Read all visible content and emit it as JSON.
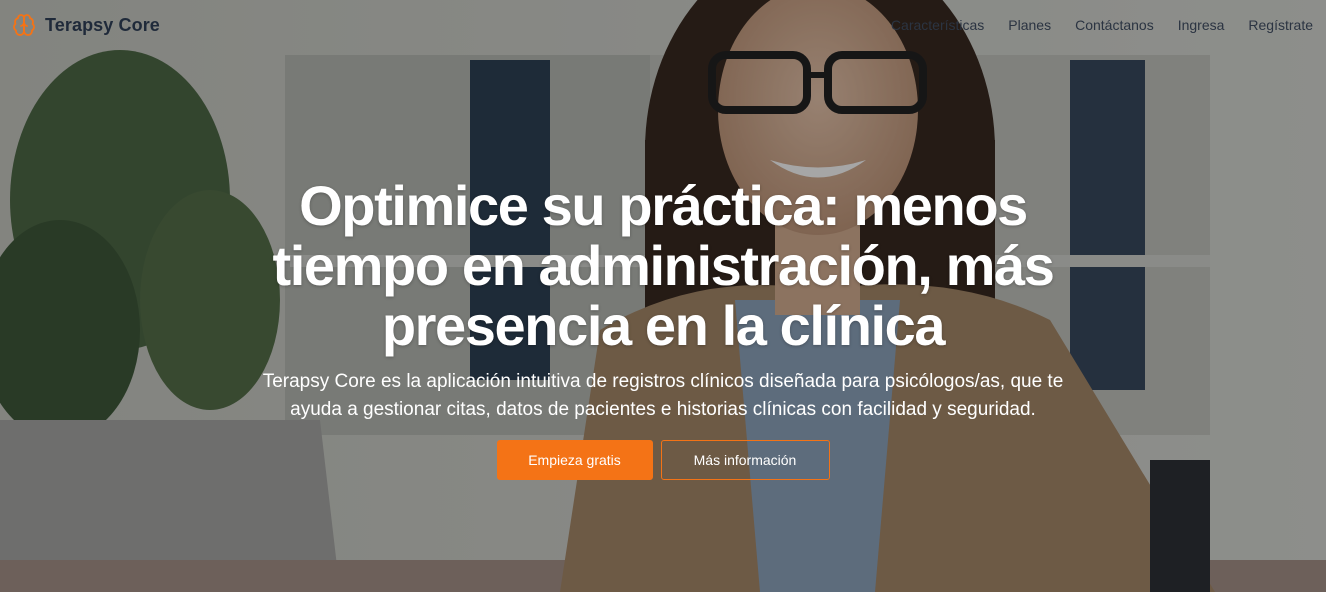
{
  "brand": {
    "name": "Terapsy Core",
    "accent_color": "#f47316",
    "icon": "brain-icon"
  },
  "nav": {
    "links": [
      {
        "label": "Características"
      },
      {
        "label": "Planes"
      },
      {
        "label": "Contáctanos"
      },
      {
        "label": "Ingresa"
      },
      {
        "label": "Regístrate"
      }
    ]
  },
  "hero": {
    "headline_lines": [
      "Optimice su práctica: menos",
      "tiempo en administración, más",
      "presencia en la clínica"
    ],
    "subtitle_lines": [
      "Terapsy Core es la aplicación intuitiva de registros clínicos diseñada para psicólogos/as, que te",
      "ayuda a gestionar citas, datos de pacientes e historias clínicas con facilidad y seguridad."
    ],
    "primary_button": "Empieza gratis",
    "secondary_button": "Más información"
  }
}
